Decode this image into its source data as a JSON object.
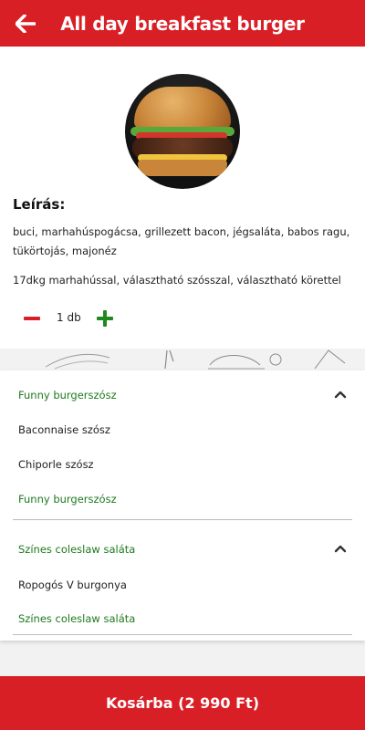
{
  "header": {
    "title": "All day breakfast burger",
    "back_icon": "arrow-left-icon"
  },
  "product": {
    "image_icon": "burger-photo",
    "description_heading": "Leírás:",
    "description": "buci, marhahúspogácsa, grillezett bacon, jégsaláta, babos ragu, tükörtojás, majonéz",
    "extra": "17dkg marhahússal, választható szósszal, választható körettel"
  },
  "quantity": {
    "value": "1 db",
    "minus_icon": "minus-icon",
    "plus_icon": "plus-icon"
  },
  "option_groups": [
    {
      "title": "Funny burgerszósz",
      "expanded": true,
      "options": [
        "Baconnaise szósz",
        "Chiporle szósz",
        "Funny burgerszósz"
      ],
      "selected": "Funny burgerszósz"
    },
    {
      "title": "Színes coleslaw saláta",
      "expanded": true,
      "options": [
        "Ropogós V burgonya",
        "Színes coleslaw saláta"
      ],
      "selected": "Színes coleslaw saláta"
    }
  ],
  "cart_button": {
    "label": "Kosárba (2 990 Ft)"
  },
  "colors": {
    "brand_red": "#d91f26",
    "selected_green": "#1e7a1e"
  }
}
